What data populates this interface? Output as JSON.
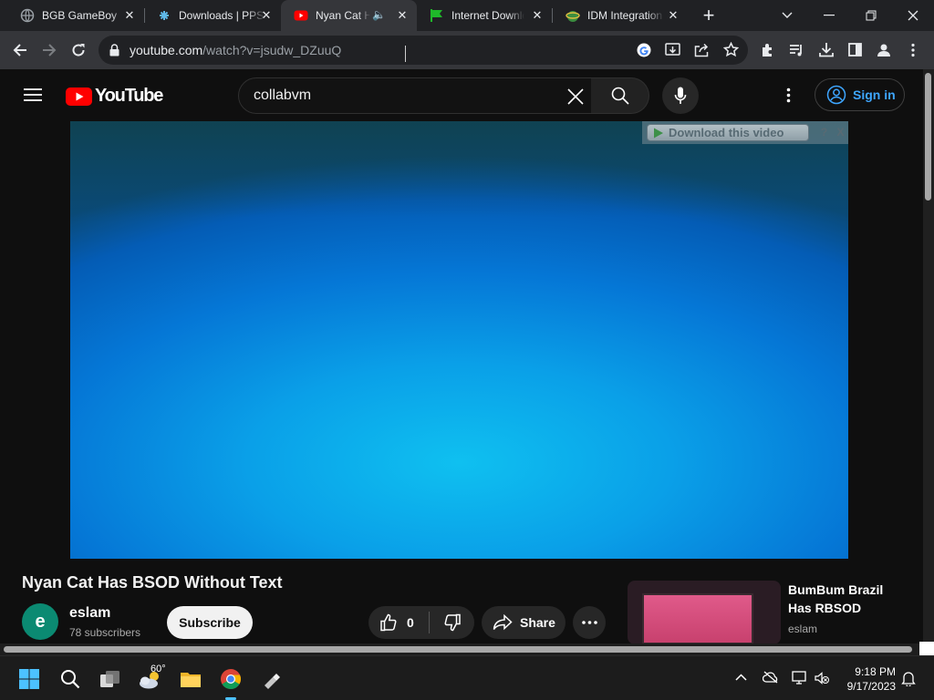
{
  "tabs": [
    {
      "title": "BGB GameBoy",
      "icon": "globe-icon"
    },
    {
      "title": "Downloads | PPSSPP",
      "icon": "ppsspp-icon"
    },
    {
      "title": "Nyan Cat Has BSOD",
      "icon": "youtube-icon",
      "active": true,
      "audio": true
    },
    {
      "title": "Internet Download Manager",
      "icon": "idm-flag-icon"
    },
    {
      "title": "IDM Integration Module",
      "icon": "idm-module-icon"
    }
  ],
  "browser": {
    "url_host": "youtube.com",
    "url_path": "/watch?v=jsudw_DZuuQ"
  },
  "youtube": {
    "logo_text": "YouTube",
    "search_value": "collabvm",
    "signin_label": "Sign in",
    "idm_download_label": "Download this video",
    "idm_help": "?",
    "idm_close": "X"
  },
  "video": {
    "title": "Nyan Cat Has BSOD Without Text",
    "channel": "eslam",
    "channel_initial": "e",
    "subscribers": "78 subscribers",
    "subscribe_label": "Subscribe",
    "likes": "0",
    "share_label": "Share"
  },
  "recommendation": {
    "title": "BumBum Brazil Has RBSOD",
    "channel": "eslam"
  },
  "taskbar": {
    "weather_temp": "60°",
    "time": "9:18 PM",
    "date": "9/17/2023"
  },
  "colors": {
    "accent": "#3ea6ff",
    "youtube_red": "#ff0000",
    "video_blue": "#0aa0e8"
  }
}
